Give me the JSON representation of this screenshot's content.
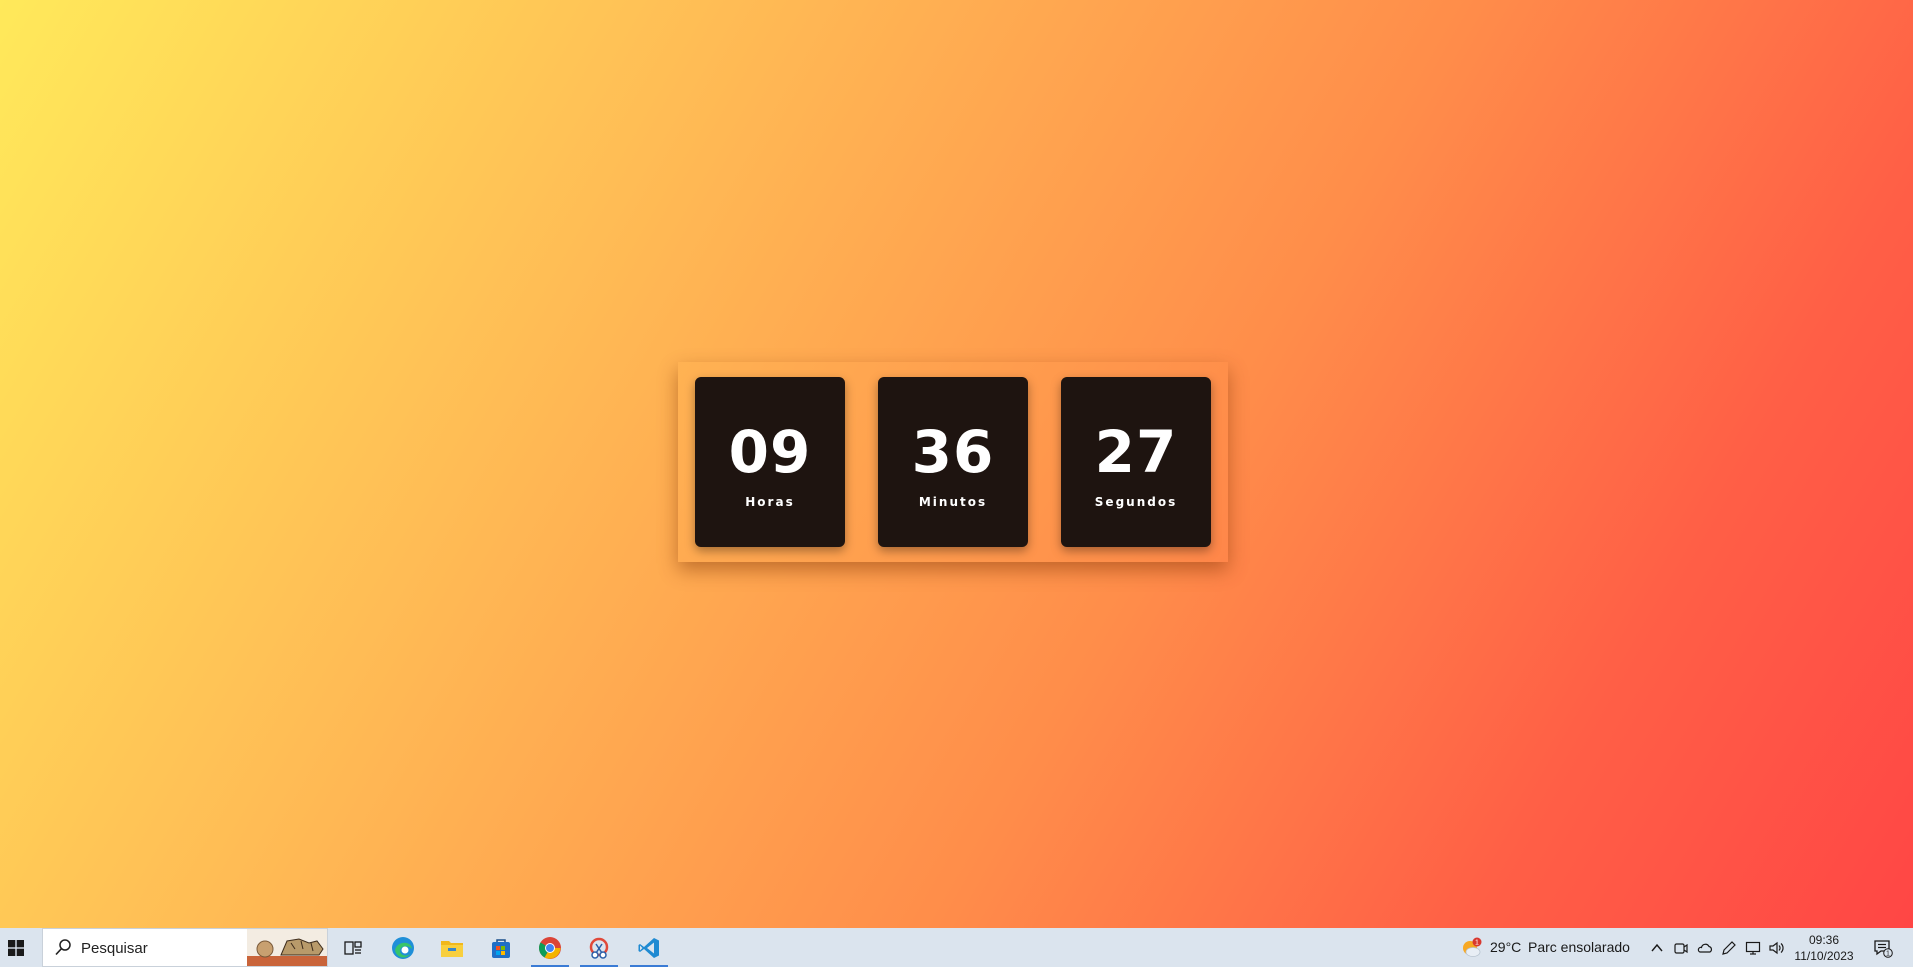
{
  "clock": {
    "hours": {
      "value": "09",
      "label": "Horas"
    },
    "minutes": {
      "value": "36",
      "label": "Minutos"
    },
    "seconds": {
      "value": "27",
      "label": "Segundos"
    }
  },
  "taskbar": {
    "search_placeholder": "Pesquisar",
    "weather_temp": "29°C",
    "weather_desc": "Parc ensolarado",
    "weather_badge": "1",
    "time": "09:36",
    "date": "11/10/2023",
    "notification_count": "1",
    "apps": [
      "task-view-icon",
      "edge-icon",
      "file-explorer-icon",
      "store-icon",
      "chrome-icon",
      "snipping-tool-icon",
      "vscode-icon"
    ]
  },
  "colors": {
    "gradient_start": "#ffe95a",
    "gradient_end": "#ff4645",
    "clock_box": "#1e1410",
    "taskbar": "#dbe4ee"
  }
}
